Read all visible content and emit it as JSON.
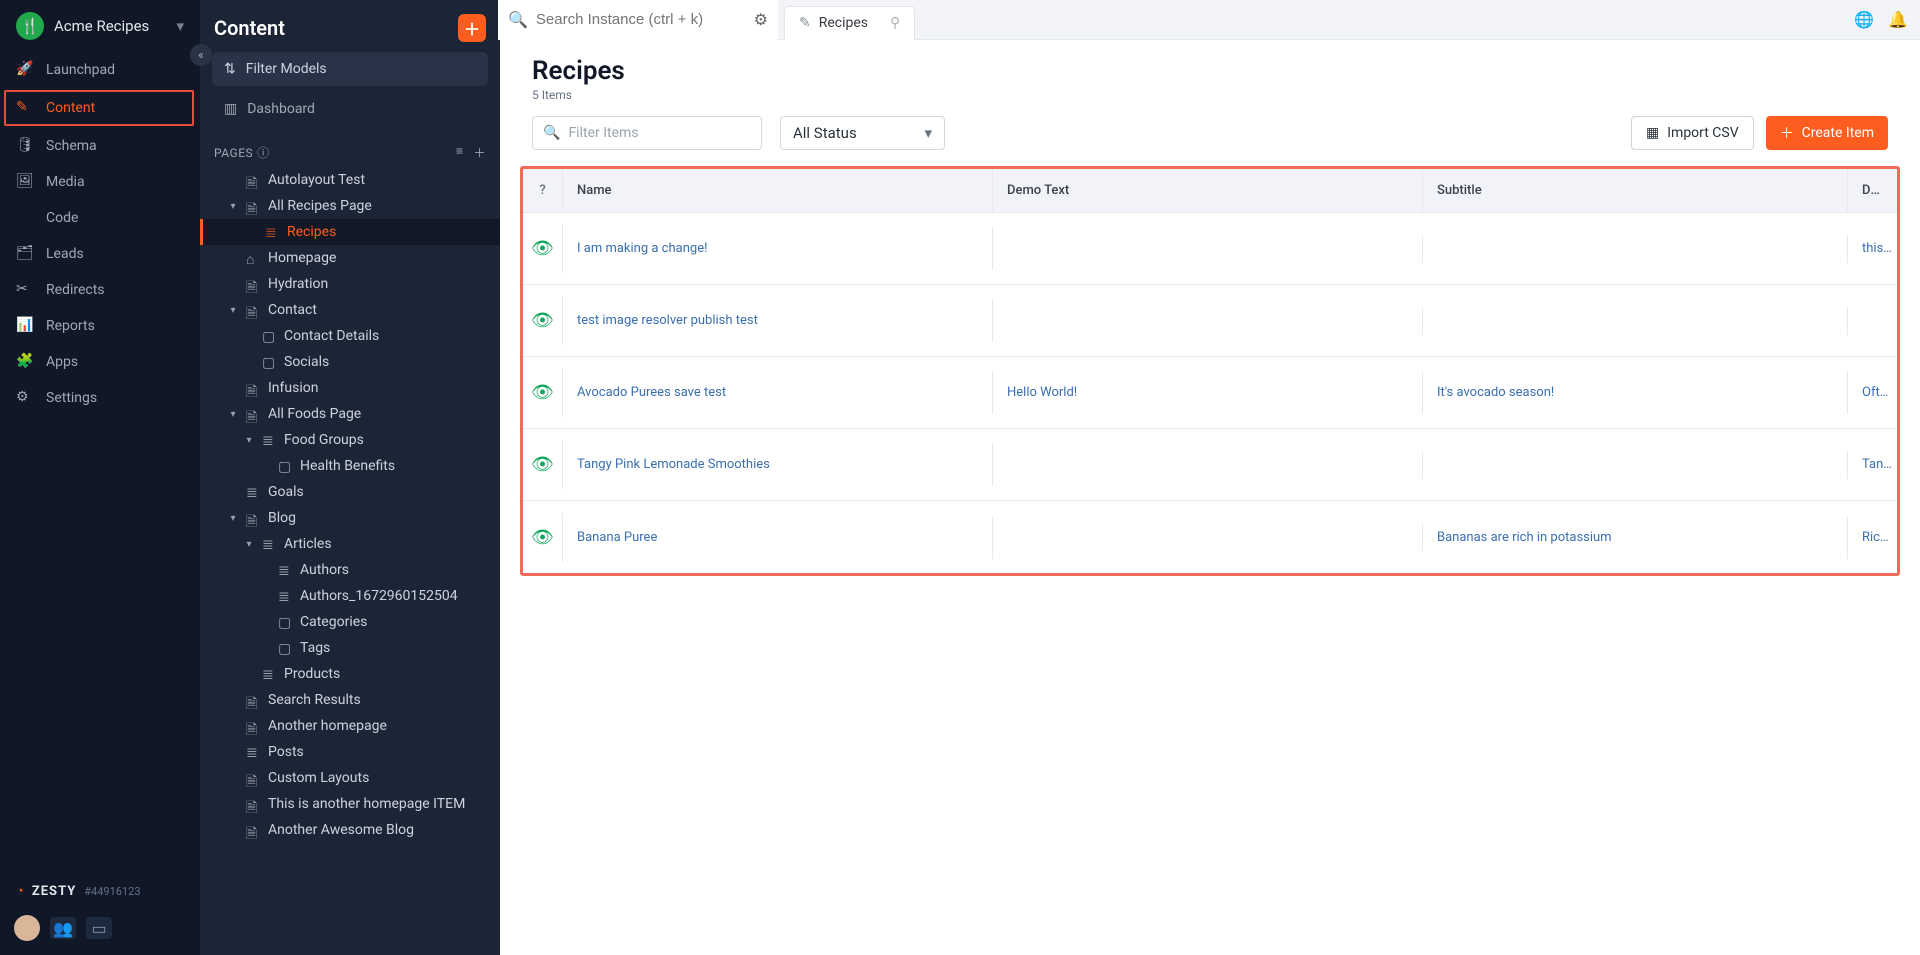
{
  "brand": {
    "name": "Acme Recipes"
  },
  "rail": {
    "items": [
      {
        "id": "launchpad",
        "label": "Launchpad"
      },
      {
        "id": "content",
        "label": "Content",
        "active": true
      },
      {
        "id": "schema",
        "label": "Schema"
      },
      {
        "id": "media",
        "label": "Media"
      },
      {
        "id": "code",
        "label": "Code"
      },
      {
        "id": "leads",
        "label": "Leads"
      },
      {
        "id": "redirects",
        "label": "Redirects"
      },
      {
        "id": "reports",
        "label": "Reports"
      },
      {
        "id": "apps",
        "label": "Apps"
      },
      {
        "id": "settings",
        "label": "Settings"
      }
    ],
    "product": "ZESTY",
    "build": "#44916123"
  },
  "contentPanel": {
    "title": "Content",
    "filterModels": "Filter Models",
    "dashboard": "Dashboard",
    "pagesHeader": "PAGES",
    "tree": [
      {
        "label": "Autolayout Test",
        "indent": 1,
        "icon": "doc"
      },
      {
        "label": "All Recipes Page",
        "indent": 1,
        "icon": "doc",
        "caret": "down"
      },
      {
        "label": "Recipes",
        "indent": 2,
        "icon": "list",
        "active": true
      },
      {
        "label": "Homepage",
        "indent": 1,
        "icon": "home",
        "caret": "blank"
      },
      {
        "label": "Hydration",
        "indent": 1,
        "icon": "doc",
        "caret": "blank"
      },
      {
        "label": "Contact",
        "indent": 1,
        "icon": "doc",
        "caret": "down"
      },
      {
        "label": "Contact Details",
        "indent": 2,
        "icon": "box"
      },
      {
        "label": "Socials",
        "indent": 2,
        "icon": "box"
      },
      {
        "label": "Infusion",
        "indent": 1,
        "icon": "doc"
      },
      {
        "label": "All Foods Page",
        "indent": 1,
        "icon": "doc",
        "caret": "down"
      },
      {
        "label": "Food Groups",
        "indent": 2,
        "icon": "list",
        "caret": "down"
      },
      {
        "label": "Health Benefits",
        "indent": 3,
        "icon": "box"
      },
      {
        "label": "Goals",
        "indent": 1,
        "icon": "list"
      },
      {
        "label": "Blog",
        "indent": 1,
        "icon": "doc",
        "caret": "down"
      },
      {
        "label": "Articles",
        "indent": 2,
        "icon": "list",
        "caret": "down"
      },
      {
        "label": "Authors",
        "indent": 3,
        "icon": "list"
      },
      {
        "label": "Authors_1672960152504",
        "indent": 3,
        "icon": "list"
      },
      {
        "label": "Categories",
        "indent": 3,
        "icon": "box"
      },
      {
        "label": "Tags",
        "indent": 3,
        "icon": "box"
      },
      {
        "label": "Products",
        "indent": 2,
        "icon": "list"
      },
      {
        "label": "Search Results",
        "indent": 1,
        "icon": "doc"
      },
      {
        "label": "Another homepage",
        "indent": 1,
        "icon": "doc"
      },
      {
        "label": "Posts",
        "indent": 1,
        "icon": "list"
      },
      {
        "label": "Custom Layouts",
        "indent": 1,
        "icon": "doc"
      },
      {
        "label": "This is another homepage ITEM",
        "indent": 1,
        "icon": "doc"
      },
      {
        "label": "Another Awesome Blog",
        "indent": 1,
        "icon": "doc"
      }
    ]
  },
  "topbar": {
    "searchPlaceholder": "Search Instance (ctrl + k)",
    "tab": "Recipes"
  },
  "page": {
    "title": "Recipes",
    "subtitle": "5 Items",
    "filterPlaceholder": "Filter Items",
    "statusLabel": "All Status",
    "importLabel": "Import CSV",
    "createLabel": "Create Item"
  },
  "table": {
    "columns": {
      "name": "Name",
      "demo": "Demo Text",
      "subtitle": "Subtitle",
      "description": "Description"
    },
    "rows": [
      {
        "name": "I am making a change!",
        "demo": "",
        "subtitle": "",
        "description": "this is the descri"
      },
      {
        "name": "test image resolver publish test",
        "demo": "",
        "subtitle": "",
        "description": ""
      },
      {
        "name": "Avocado Purees save test",
        "demo": "Hello World!",
        "subtitle": "It's avocado season!",
        "description": "Often called the vitamins, minera"
      },
      {
        "name": "Tangy Pink Lemonade Smoothies",
        "demo": "",
        "subtitle": "",
        "description": "Tangy, pink and with this light n'"
      },
      {
        "name": "Banana Puree",
        "demo": "",
        "subtitle": "Bananas are rich in potassium",
        "description": "Rich in potassiu banana is a hea"
      }
    ]
  }
}
